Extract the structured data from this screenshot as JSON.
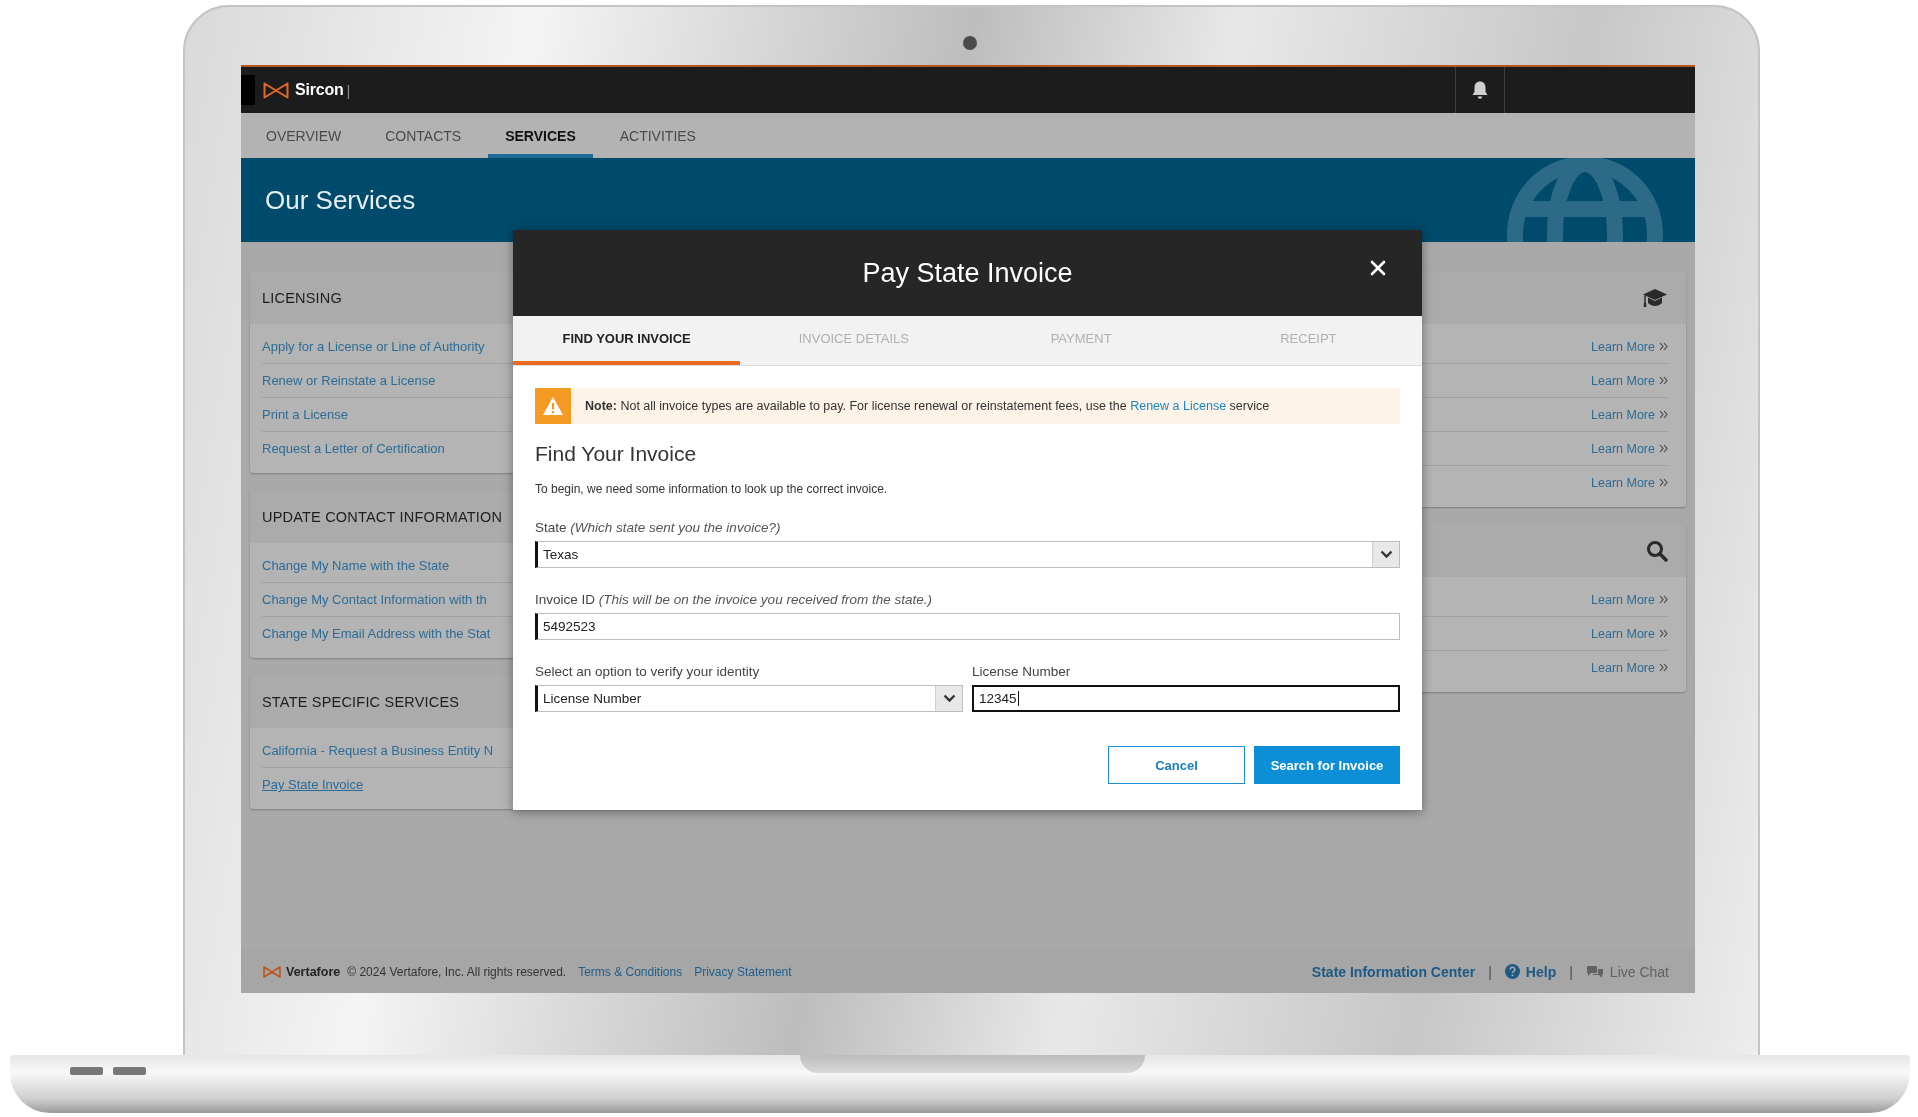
{
  "header": {
    "brand": "Sircon",
    "separator": "|"
  },
  "nav_tabs": [
    {
      "label": "OVERVIEW",
      "selected": false
    },
    {
      "label": "CONTACTS",
      "selected": false
    },
    {
      "label": "SERVICES",
      "selected": true
    },
    {
      "label": "ACTIVITIES",
      "selected": false
    }
  ],
  "banner": {
    "title": "Our Services"
  },
  "left_cards": [
    {
      "title": "LICENSING",
      "links": [
        {
          "label": "Apply for a License or Line of Authority",
          "current": false
        },
        {
          "label": "Renew or Reinstate a License",
          "current": false
        },
        {
          "label": "Print a License",
          "current": false
        },
        {
          "label": "Request a Letter of Certification",
          "current": false
        }
      ]
    },
    {
      "title": "UPDATE CONTACT INFORMATION",
      "links": [
        {
          "label": "Change My Name with the State",
          "current": false
        },
        {
          "label": "Change My Contact Information with th",
          "current": false
        },
        {
          "label": "Change My Email Address with the Stat",
          "current": false
        }
      ]
    },
    {
      "title": "STATE SPECIFIC SERVICES",
      "links": [
        {
          "label": "California - Request a Business Entity N",
          "current": false
        },
        {
          "label": "Pay State Invoice",
          "current": true
        }
      ]
    }
  ],
  "right_cards": [
    {
      "links": [
        "Learn More",
        "Learn More",
        "Learn More",
        "Learn More",
        "Learn More"
      ]
    },
    {
      "links": [
        "Learn More",
        "Learn More",
        "Learn More"
      ]
    }
  ],
  "modal": {
    "title": "Pay State Invoice",
    "steps": [
      {
        "label": "FIND YOUR INVOICE",
        "selected": true
      },
      {
        "label": "INVOICE DETAILS",
        "selected": false
      },
      {
        "label": "PAYMENT",
        "selected": false
      },
      {
        "label": "RECEIPT",
        "selected": false
      }
    ],
    "note": {
      "text": "**Note:** Not all invoice types are available to pay. For license renewal or reinstatement fees, use the",
      "link": "Renew a License",
      "text_after": "service"
    },
    "heading": "Find Your Invoice",
    "intro": "To begin, we need some information to look up the correct invoice.",
    "state": {
      "label": "State",
      "hint": "(Which state sent you the invoice?)",
      "value": "Texas"
    },
    "invoice_id": {
      "label": "Invoice ID",
      "hint": "(This will be on the invoice you received from the state.)",
      "value": "5492523"
    },
    "verify": {
      "label": "Select an option to verify your identity",
      "value": "License Number"
    },
    "license_number": {
      "label": "License Number",
      "value": "12345",
      "focused": true
    },
    "buttons": [
      {
        "label": "Cancel",
        "kind": "secondary"
      },
      {
        "label": "Search for Invoice",
        "kind": "primary"
      }
    ]
  },
  "footer": {
    "brand": "Vertafore",
    "copyright": "© 2024 Vertafore, Inc. All rights reserved.",
    "links": [
      "Terms & Conditions",
      "Privacy Statement"
    ],
    "right": [
      {
        "label": "State Information Center",
        "kind": "link",
        "disabled": false
      },
      {
        "label": "|",
        "kind": "separator"
      },
      {
        "label": "Help",
        "kind": "help",
        "disabled": false
      },
      {
        "label": "|",
        "kind": "separator"
      },
      {
        "label": "Live Chat",
        "kind": "chat",
        "disabled": true
      }
    ]
  }
}
